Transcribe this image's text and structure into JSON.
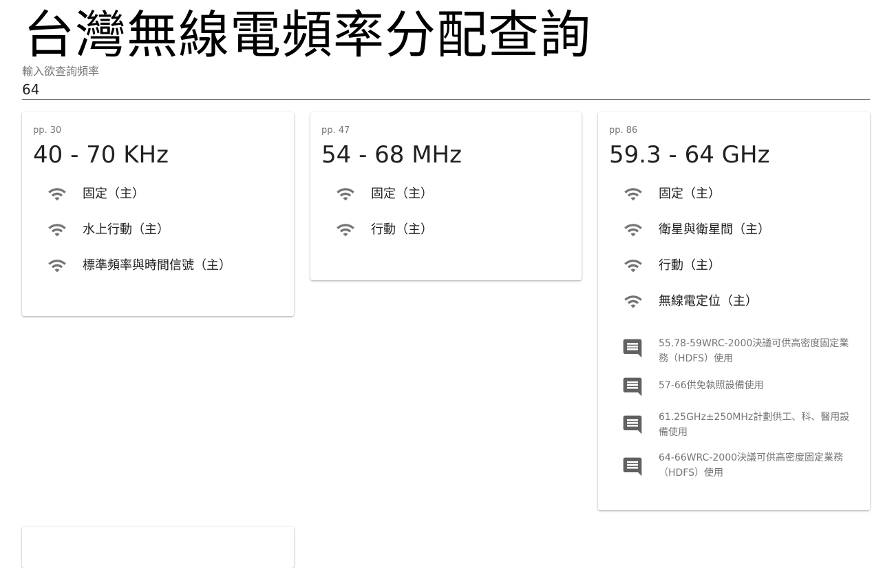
{
  "header": {
    "title": "台灣無線電頻率分配查詢"
  },
  "search": {
    "label": "輸入欲查詢頻率",
    "value": "64"
  },
  "icons": {
    "service": "wifi-icon",
    "note": "comment-icon"
  },
  "cards": [
    {
      "page": "pp. 30",
      "range": "40 - 70 KHz",
      "services": [
        "固定（主）",
        "水上行動（主）",
        "標準頻率與時間信號（主）"
      ],
      "notes": []
    },
    {
      "page": "pp. 47",
      "range": "54 - 68 MHz",
      "services": [
        "固定（主）",
        "行動（主）"
      ],
      "notes": []
    },
    {
      "page": "pp. 86",
      "range": "59.3 - 64 GHz",
      "services": [
        "固定（主）",
        "衛星與衛星間（主）",
        "行動（主）",
        "無線電定位（主）"
      ],
      "notes": [
        "55.78-59WRC-2000決議可供高密度固定業務（HDFS）使用",
        "57-66供免執照設備使用",
        "61.25GHz±250MHz計劃供工、科、醫用設備使用",
        "64-66WRC-2000決議可供高密度固定業務（HDFS）使用"
      ]
    }
  ]
}
